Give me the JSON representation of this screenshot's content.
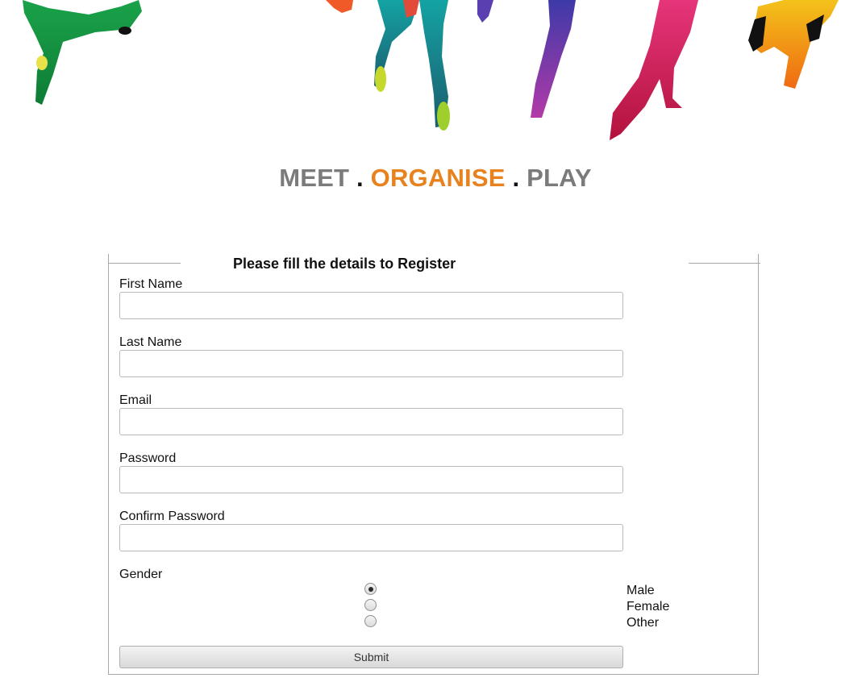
{
  "tagline": {
    "meet": "MEET",
    "dot1": " . ",
    "organise": "ORGANISE",
    "dot2": " . ",
    "play": "PLAY"
  },
  "colors": {
    "tag_grey": "#7b7b7b",
    "tag_orange": "#e8821e"
  },
  "hero": {
    "icon": "runners-illustration-icon"
  },
  "form": {
    "legend": "Please fill the details to Register",
    "fields": {
      "first_name": {
        "label": "First Name",
        "value": ""
      },
      "last_name": {
        "label": "Last Name",
        "value": ""
      },
      "email": {
        "label": "Email",
        "value": ""
      },
      "password": {
        "label": "Password",
        "value": ""
      },
      "confirm_password": {
        "label": "Confirm Password",
        "value": ""
      }
    },
    "gender": {
      "label": "Gender",
      "options": [
        "Male",
        "Female",
        "Other"
      ],
      "selected": "Male"
    },
    "submit_label": "Submit"
  }
}
